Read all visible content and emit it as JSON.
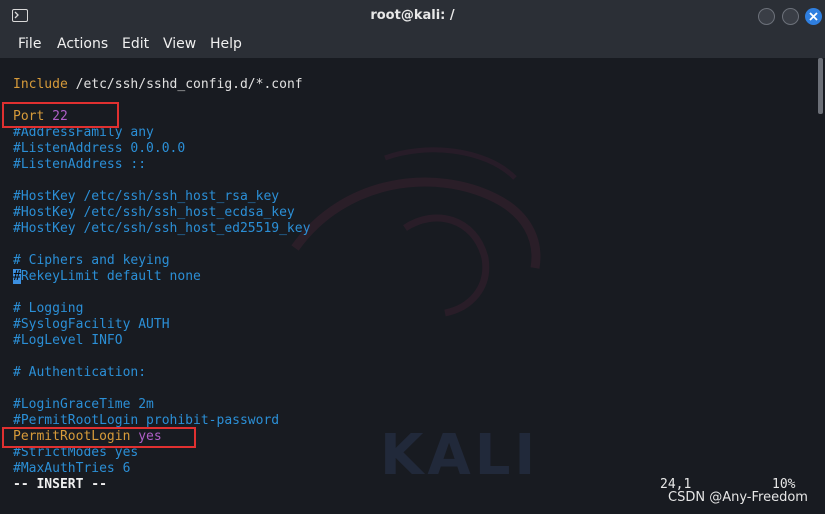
{
  "window": {
    "title": "root@kali: /"
  },
  "menu": [
    "File",
    "Actions",
    "Edit",
    "View",
    "Help"
  ],
  "lines": [
    {
      "tokens": [
        {
          "t": "Include",
          "c": "kw"
        },
        {
          "t": " /etc/ssh/sshd_config.d/*.conf",
          "c": "plain"
        }
      ]
    },
    {
      "tokens": []
    },
    {
      "tokens": [
        {
          "t": "Port",
          "c": "kw"
        },
        {
          "t": " ",
          "c": "plain"
        },
        {
          "t": "22",
          "c": "num"
        }
      ]
    },
    {
      "tokens": [
        {
          "t": "#AddressFamily any",
          "c": "cm"
        }
      ]
    },
    {
      "tokens": [
        {
          "t": "#ListenAddress 0.0.0.0",
          "c": "cm"
        }
      ]
    },
    {
      "tokens": [
        {
          "t": "#ListenAddress ::",
          "c": "cm"
        }
      ]
    },
    {
      "tokens": []
    },
    {
      "tokens": [
        {
          "t": "#HostKey /etc/ssh/ssh_host_rsa_key",
          "c": "cm"
        }
      ]
    },
    {
      "tokens": [
        {
          "t": "#HostKey /etc/ssh/ssh_host_ecdsa_key",
          "c": "cm"
        }
      ]
    },
    {
      "tokens": [
        {
          "t": "#HostKey /etc/ssh/ssh_host_ed25519_key",
          "c": "cm"
        }
      ]
    },
    {
      "tokens": []
    },
    {
      "tokens": [
        {
          "t": "# Ciphers and keying",
          "c": "cm"
        }
      ]
    },
    {
      "tokens": [
        {
          "t": "#",
          "c": "cursor"
        },
        {
          "t": "RekeyLimit default none",
          "c": "cm"
        }
      ]
    },
    {
      "tokens": []
    },
    {
      "tokens": [
        {
          "t": "# Logging",
          "c": "cm"
        }
      ]
    },
    {
      "tokens": [
        {
          "t": "#SyslogFacility AUTH",
          "c": "cm"
        }
      ]
    },
    {
      "tokens": [
        {
          "t": "#LogLevel INFO",
          "c": "cm"
        }
      ]
    },
    {
      "tokens": []
    },
    {
      "tokens": [
        {
          "t": "# Authentication:",
          "c": "cm"
        }
      ]
    },
    {
      "tokens": []
    },
    {
      "tokens": [
        {
          "t": "#LoginGraceTime 2m",
          "c": "cm"
        }
      ]
    },
    {
      "tokens": [
        {
          "t": "#PermitRootLogin prohibit-password",
          "c": "cm"
        }
      ]
    },
    {
      "tokens": [
        {
          "t": "PermitRootLogin",
          "c": "kw"
        },
        {
          "t": " ",
          "c": "plain"
        },
        {
          "t": "yes",
          "c": "num"
        }
      ]
    },
    {
      "tokens": [
        {
          "t": "#StrictModes yes",
          "c": "cm"
        }
      ]
    },
    {
      "tokens": [
        {
          "t": "#MaxAuthTries 6",
          "c": "cm"
        }
      ]
    }
  ],
  "status": {
    "mode": "-- INSERT --",
    "position": "24,1",
    "percent": "10%"
  },
  "watermark": {
    "text": "KALI",
    "csdn": "CSDN @Any-Freedom"
  },
  "colors": {
    "comment": "#2b8fd6",
    "keyword": "#d79b3a",
    "value": "#b05fc8",
    "highlight": "#e03030"
  }
}
